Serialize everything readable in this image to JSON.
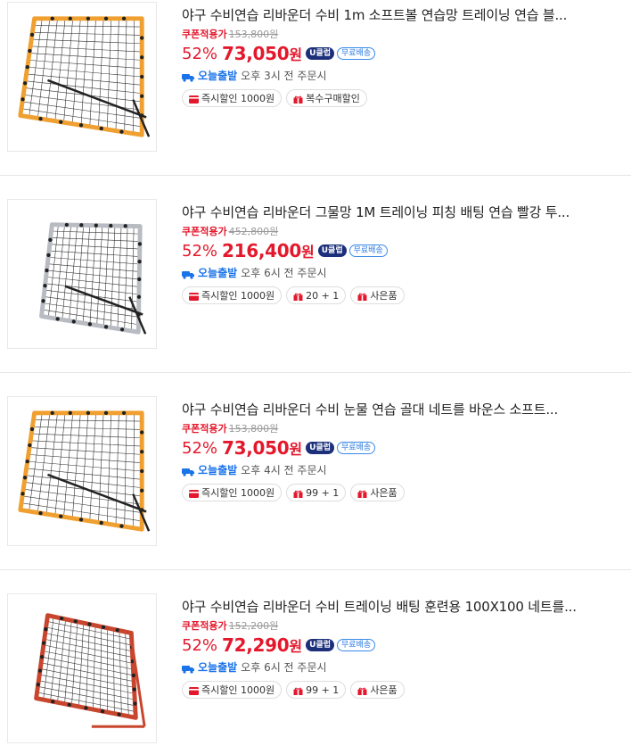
{
  "products": [
    {
      "title": "야구 수비연습 리바운더 수비 1m 소프트볼 연습망 트레이닝 연습 블...",
      "coupon_label": "쿠폰적용가",
      "original_price": "153,800원",
      "discount": "52%",
      "price": "73,050",
      "won": "원",
      "uclub": "U클럽",
      "free_ship": "무료배송",
      "ship_brand": "오늘출발",
      "ship_time": "오후 3시 전 주문시",
      "badges": [
        {
          "icon": "card-icon",
          "label": "즉시할인 1000원"
        },
        {
          "icon": "gift-icon",
          "label": "복수구매할인"
        }
      ],
      "image": "orange-frame-rebounder"
    },
    {
      "title": "야구 수비연습 리바운더 그물망 1M 트레이닝 피칭 배팅 연습 빨강 투...",
      "coupon_label": "쿠폰적용가",
      "original_price": "452,800원",
      "discount": "52%",
      "price": "216,400",
      "won": "원",
      "uclub": "U클럽",
      "free_ship": "무료배송",
      "ship_brand": "오늘출발",
      "ship_time": "오후 6시 전 주문시",
      "badges": [
        {
          "icon": "card-icon",
          "label": "즉시할인 1000원"
        },
        {
          "icon": "gift-icon",
          "label": "20 + 1"
        },
        {
          "icon": "gift-icon",
          "label": "사은품"
        }
      ],
      "image": "silver-frame-rebounder"
    },
    {
      "title": "야구 수비연습 리바운더 수비 눈물 연습 골대 네트를 바운스 소프트...",
      "coupon_label": "쿠폰적용가",
      "original_price": "153,800원",
      "discount": "52%",
      "price": "73,050",
      "won": "원",
      "uclub": "U클럽",
      "free_ship": "무료배송",
      "ship_brand": "오늘출발",
      "ship_time": "오후 4시 전 주문시",
      "badges": [
        {
          "icon": "card-icon",
          "label": "즉시할인 1000원"
        },
        {
          "icon": "gift-icon",
          "label": "99 + 1"
        },
        {
          "icon": "gift-icon",
          "label": "사은품"
        }
      ],
      "image": "orange-frame-rebounder"
    },
    {
      "title": "야구 수비연습 리바운더 수비 트레이닝 배팅 훈련용 100X100 네트를...",
      "coupon_label": "쿠폰적용가",
      "original_price": "152,200원",
      "discount": "52%",
      "price": "72,290",
      "won": "원",
      "uclub": "U클럽",
      "free_ship": "무료배송",
      "ship_brand": "오늘출발",
      "ship_time": "오후 6시 전 주문시",
      "badges": [
        {
          "icon": "card-icon",
          "label": "즉시할인 1000원"
        },
        {
          "icon": "gift-icon",
          "label": "99 + 1"
        },
        {
          "icon": "gift-icon",
          "label": "사은품"
        }
      ],
      "image": "red-frame-rebounder"
    }
  ],
  "colors": {
    "sale_red": "#e4182c",
    "uclub_navy": "#1b2f7a",
    "ship_blue": "#1a73e8",
    "frame_orange": "#f0a030",
    "frame_silver": "#b8bcc2",
    "frame_red": "#c8462e"
  }
}
